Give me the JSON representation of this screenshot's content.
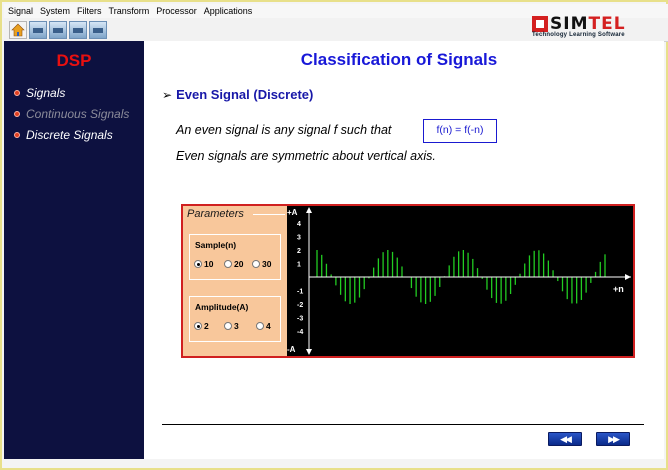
{
  "menu": [
    "Signal",
    "System",
    "Filters",
    "Transform",
    "Processor",
    "Applications"
  ],
  "toolbar": {
    "icons": [
      "home-icon",
      "back-icon",
      "forward-icon",
      "print-icon",
      "exit-icon"
    ]
  },
  "logo": {
    "brand_a": "SIM",
    "brand_b": "TEL",
    "tagline": "Technology Learning Software"
  },
  "sidebar": {
    "title": "DSP",
    "items": [
      {
        "label": "Signals",
        "active": true
      },
      {
        "label": "Continuous Signals",
        "active": false
      },
      {
        "label": "Discrete Signals",
        "active": true
      }
    ]
  },
  "main": {
    "title": "Classification of Signals",
    "section": "Even Signal (Discrete)",
    "line1": "An even signal is any signal f such that",
    "formula": "f(n) = f(-n)",
    "line2": "Even signals are symmetric about vertical axis."
  },
  "params": {
    "title": "Parameters",
    "sample_label": "Sample(n)",
    "sample_options": [
      "10",
      "20",
      "30"
    ],
    "sample_selected": "10",
    "amp_label": "Amplitude(A)",
    "amp_options": [
      "2",
      "3",
      "4"
    ],
    "amp_selected": "2"
  },
  "chart_data": {
    "type": "bar",
    "title": "",
    "y_top_label": "+A",
    "y_bottom_label": "-A",
    "x_label": "+n",
    "yticks": [
      4,
      3,
      2,
      1,
      -1,
      -2,
      -3,
      -4
    ],
    "ylim": [
      -4.5,
      4.5
    ],
    "color": "#22cc22",
    "values": [
      2.0,
      1.64,
      0.98,
      0.19,
      -0.62,
      -1.32,
      -1.8,
      -2.0,
      -1.9,
      -1.52,
      -0.9,
      -0.1,
      0.7,
      1.38,
      1.84,
      2.0,
      1.86,
      1.44,
      0.78,
      -0.02,
      -0.82,
      -1.46,
      -1.88,
      -2.0,
      -1.84,
      -1.4,
      -0.74,
      0.06,
      0.86,
      1.5,
      1.9,
      2.0,
      1.8,
      1.34,
      0.66,
      -0.14,
      -0.94,
      -1.56,
      -1.92,
      -1.98,
      -1.76,
      -1.26,
      -0.58,
      0.24,
      1.0,
      1.6,
      1.94,
      1.98,
      1.74,
      1.22,
      0.5,
      -0.3,
      -1.06,
      -1.64,
      -1.96,
      -1.96,
      -1.7,
      -1.16,
      -0.44,
      0.38,
      1.12,
      1.68
    ]
  },
  "nav": {
    "prev_icon": "rewind-icon",
    "next_icon": "fast-forward-icon",
    "prev_glyph": "◀◀",
    "next_glyph": "▶▶"
  }
}
